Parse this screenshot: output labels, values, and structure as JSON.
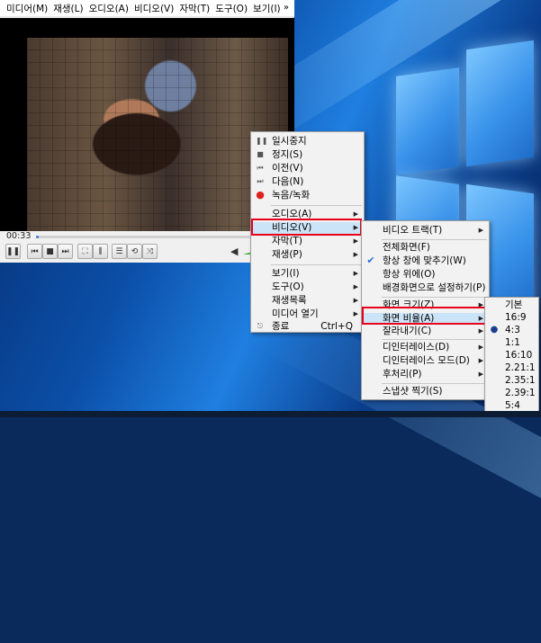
{
  "vlc": {
    "menubar": [
      "미디어(M)",
      "재생(L)",
      "오디오(A)",
      "비디오(V)",
      "자막(T)",
      "도구(O)",
      "보기(I)"
    ],
    "more": "»",
    "time": "00:33",
    "progress_fraction": 0.01,
    "volume_icon": "speaker-icon"
  },
  "main_menu": {
    "items": [
      {
        "label": "일시중지",
        "icon": "pause-icon"
      },
      {
        "label": "정지(S)",
        "icon": "stop-icon"
      },
      {
        "label": "이전(V)",
        "icon": "previous-icon"
      },
      {
        "label": "다음(N)",
        "icon": "next-icon"
      },
      {
        "label": "녹음/녹화",
        "icon": "record-icon"
      },
      {
        "label": "오디오(A)"
      },
      {
        "label": "비디오(V)"
      },
      {
        "label": "자막(T)"
      },
      {
        "label": "재생(P)"
      },
      {
        "label": "보기(I)"
      },
      {
        "label": "도구(O)"
      },
      {
        "label": "재생목록"
      },
      {
        "label": "미디어 열기"
      },
      {
        "label": "종료",
        "icon": "quit-icon",
        "shortcut": "Ctrl+Q"
      }
    ]
  },
  "video_menu": {
    "items": [
      {
        "label": "비디오 트랙(T)"
      },
      {
        "label": "전체화면(F)"
      },
      {
        "label": "항상 창에 맞추기(W)",
        "checked": true
      },
      {
        "label": "항상 위에(O)"
      },
      {
        "label": "배경화면으로 설정하기(P)"
      },
      {
        "label": "화면 크기(Z)"
      },
      {
        "label": "화면 비율(A)"
      },
      {
        "label": "잘라내기(C)"
      },
      {
        "label": "디인터레이스(D)"
      },
      {
        "label": "디인터레이스 모드(D)"
      },
      {
        "label": "후처리(P)"
      },
      {
        "label": "스냅샷 찍기(S)"
      }
    ]
  },
  "ratio_menu": {
    "items": [
      "기본",
      "16:9",
      "4:3",
      "1:1",
      "16:10",
      "2.21:1",
      "2.35:1",
      "2.39:1",
      "5:4"
    ],
    "selected": "4:3"
  },
  "colors": {
    "highlight": "#cce4f7",
    "callout": "#e8001c"
  }
}
